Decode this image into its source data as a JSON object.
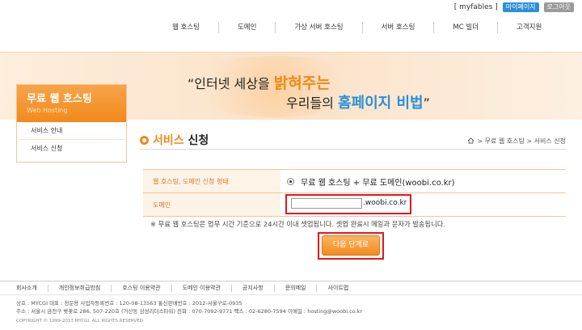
{
  "topbar": {
    "user": "[ myfables ]",
    "mypage": "마이페이지",
    "logout": "로그아웃"
  },
  "nav": [
    "웹 호스팅",
    "도메인",
    "가상 서버 호스팅",
    "서버 호스팅",
    "MC 빌더",
    "고객지원"
  ],
  "banner": {
    "line1_pre": "“인터넷 세상을 ",
    "line1_hl": "밝혀주는",
    "line2_pre": "우리들의 ",
    "line2_hl": "홈페이지 비법",
    "line2_post": "”"
  },
  "sidebar": {
    "title": "무료 웹 호스팅",
    "subtitle": "Web Hosting",
    "items": [
      {
        "label": "서비스 안내"
      },
      {
        "label": "서비스 신청"
      }
    ]
  },
  "page": {
    "title_orange": "서비스",
    "title_dark": " 신청",
    "breadcrumb": "> 무료 웹 호스팅 > 서비스 신청"
  },
  "form": {
    "row1_label": "웹 호스팅, 도메인 신청 형태",
    "row1_value": "무료 웹 호스팅 + 무료 도메인(woobi.co.kr)",
    "row2_label": "도메인",
    "domain_value": "",
    "domain_suffix": ".woobi.co.kr"
  },
  "notice": "※ 무료 웹 호스팅은 업무 시간 기준으로 24시간 이내 셋업됩니다. 셋업 완료시 메일과 문자가 발송됩니다.",
  "next_button": "다음 단계로",
  "footer": {
    "links": [
      "회사소개",
      "개인정보취급방침",
      "호스팅 이용약관",
      "도메인 이용약관",
      "공지사항",
      "문의메일",
      "사이트맵"
    ],
    "info1": "상호 : MYCGI    대표 : 정문용    사업자등록번호 : 120-08-13563    통신판매번호 : 2012-서울구로-0935",
    "info2": "주소 : 서울시 금천구 벚꽃로 286, 507-220호 (가산동 삼성리더스타워)    전화 : 070-7092-9771    팩스 : 02-6280-7594    이메일 : hosting@woobi.co.kr",
    "copyright": "COPYRIGHT © 1999-2013 MYCGI. ALL RIGHTS RESERVED."
  },
  "colors": {
    "accent": "#f28a1c",
    "blue": "#2a8fd8",
    "highlight_box": "#e3171f"
  }
}
